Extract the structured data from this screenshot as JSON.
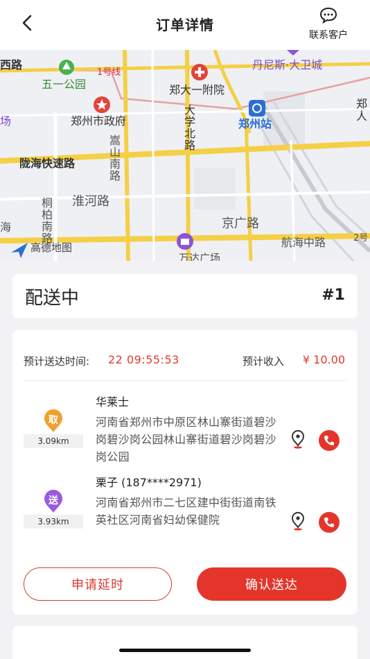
{
  "header": {
    "title": "订单详情",
    "contact_label": "联系客户"
  },
  "map": {
    "labels": {
      "xilu": "西路",
      "wuyi_park": "五一公园",
      "line1": "1号线",
      "zhengda_hospital": "郑大一附院",
      "dennis": "丹尼斯·大卫城",
      "zheng_right": "郑",
      "ren_right": "人",
      "chang": "场",
      "gov": "郑州市政府",
      "daxue_beilu": "大学北路",
      "station": "郑州站",
      "songshan_nanlu": "嵩山南路",
      "longhai": "陇海快速路",
      "huaihe": "淮河路",
      "tongbai": "桐柏南路",
      "hai": "海",
      "jingguang": "京广路",
      "gaode": "高德地图",
      "hanghai": "航海中路",
      "wanda": "万达广场",
      "line2": "2号"
    }
  },
  "order": {
    "status": "配送中",
    "number": "#1",
    "eta_label": "预计送达时间:",
    "eta_value": "22 09:55:53",
    "income_label": "预计收入",
    "income_value": "¥ 10.00"
  },
  "pickup": {
    "tag": "取",
    "distance": "3.09km",
    "name": "华莱士",
    "address": "河南省郑州市中原区林山寨街道碧沙岗碧沙岗公园林山寨街道碧沙岗碧沙岗公园"
  },
  "dropoff": {
    "tag": "送",
    "distance": "3.93km",
    "name": "栗子 (187****2971)",
    "address": "河南省郑州市二七区建中街街道南铁英社区河南省妇幼保健院"
  },
  "actions": {
    "delay_label": "申请延时",
    "confirm_label": "确认送达"
  },
  "colors": {
    "accent": "#e5352b",
    "pickup_pin": "#f0a030",
    "dropoff_pin": "#9a5ae0"
  }
}
